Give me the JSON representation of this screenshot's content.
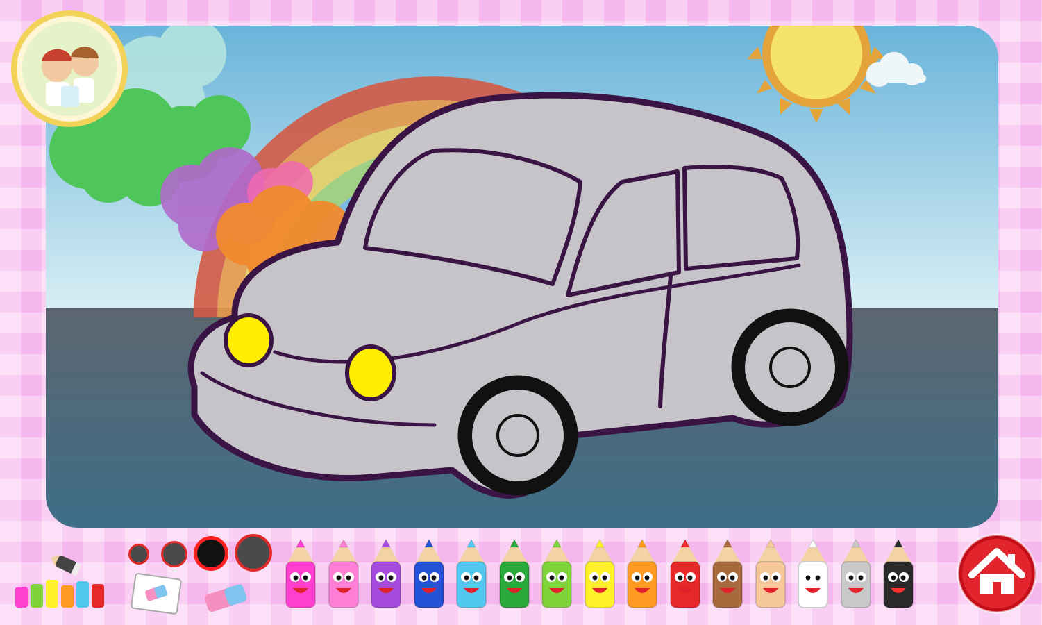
{
  "game": {
    "logo": {
      "icon": "kids-cartoon-logo-icon"
    },
    "drawing": {
      "subject": "car-outline"
    },
    "palette": {
      "pencils": [
        {
          "color": "#ff3fd0"
        },
        {
          "color": "#ff7fd6"
        },
        {
          "color": "#a64be0"
        },
        {
          "color": "#2453d8"
        },
        {
          "color": "#52c8f0"
        },
        {
          "color": "#2aaa3a"
        },
        {
          "color": "#7ed43a"
        },
        {
          "color": "#fff22a"
        },
        {
          "color": "#ff9a22"
        },
        {
          "color": "#e62828"
        },
        {
          "color": "#a86a3c"
        },
        {
          "color": "#f6c89a"
        },
        {
          "color": "#ffffff"
        },
        {
          "color": "#c8c8c8"
        },
        {
          "color": "#2a2a2a"
        }
      ],
      "selected_color": "#fff22a"
    },
    "brush_sizes": [
      "small",
      "medium",
      "large",
      "xlarge"
    ],
    "selected_brush": "large",
    "tools": [
      "eraser-icon",
      "clear-page-icon",
      "pencil-box-icon"
    ],
    "home_icon": "home-icon"
  }
}
